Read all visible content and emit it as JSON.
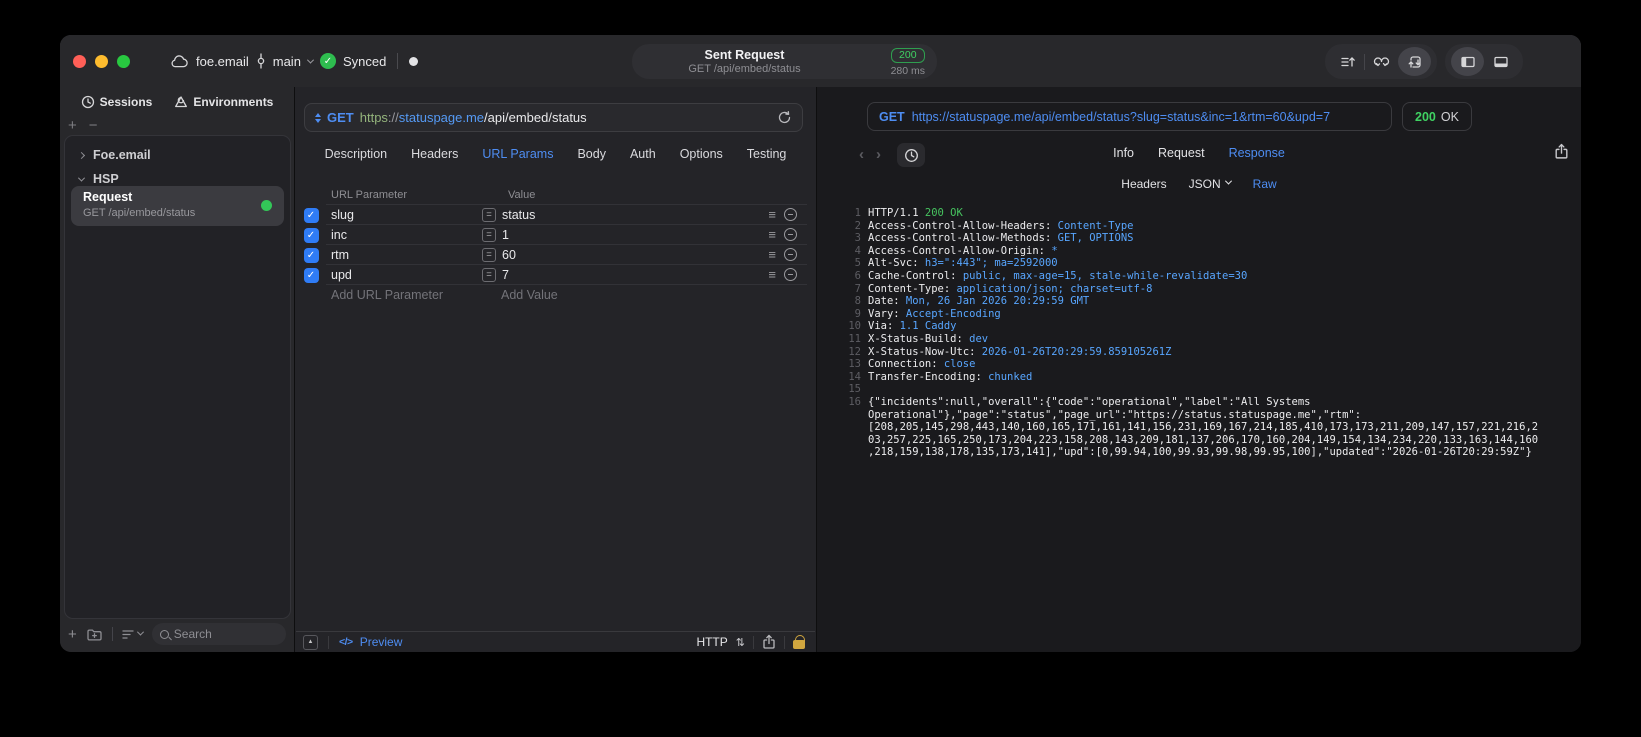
{
  "colors": {
    "accent_blue": "#4e8df2",
    "status_green": "#3fd162",
    "checkbox_blue": "#2f7cf6",
    "lock_gold": "#d0a63f",
    "value_blue": "#58a6ff"
  },
  "icons": {
    "check": "✓",
    "equals": "=",
    "hamburger": "≡",
    "sort": "⇅",
    "code": "</>",
    "back": "‹",
    "forward": "›",
    "plus": "+",
    "minus": "−",
    "up_triangle": "▲"
  },
  "titlebar": {
    "project": "foe.email",
    "branch": "main",
    "sync_status": "Synced",
    "request_title": "Sent Request",
    "request_subtitle": "GET /api/embed/status",
    "status_code": "200",
    "duration": "280 ms"
  },
  "sidebar": {
    "tabs": [
      "Sessions",
      "Environments"
    ],
    "tree": [
      {
        "label": "Foe.email"
      },
      {
        "label": "HSP"
      }
    ],
    "selected_request": {
      "title": "Request",
      "subtitle": "GET /api/embed/status"
    },
    "search_placeholder": "Search"
  },
  "request_editor": {
    "method": "GET",
    "url": {
      "scheme": "https",
      "sep": "://",
      "host": "statuspage.me",
      "path": "/api/embed/status"
    },
    "tabs": [
      "Description",
      "Headers",
      "URL Params",
      "Body",
      "Auth",
      "Options",
      "Testing"
    ],
    "active_tab": "URL Params",
    "params": {
      "columns": [
        "URL Parameter",
        "Value"
      ],
      "rows": [
        {
          "checked": true,
          "name": "slug",
          "value": "status"
        },
        {
          "checked": true,
          "name": "inc",
          "value": "1"
        },
        {
          "checked": true,
          "name": "rtm",
          "value": "60"
        },
        {
          "checked": true,
          "name": "upd",
          "value": "7"
        }
      ],
      "add_name_placeholder": "Add URL Parameter",
      "add_value_placeholder": "Add Value"
    },
    "footer": {
      "preview_label": "Preview",
      "protocol": "HTTP"
    }
  },
  "response_viewer": {
    "method": "GET",
    "url": "https://statuspage.me/api/embed/status?slug=status&inc=1&rtm=60&upd=7",
    "status": {
      "code": "200",
      "text": "OK"
    },
    "tabs": [
      "Info",
      "Request",
      "Response"
    ],
    "active_tab": "Response",
    "subtabs": [
      "Headers",
      "JSON",
      "Raw"
    ],
    "active_subtab": "Raw",
    "status_line": {
      "num": "1",
      "protocol": "HTTP/1.1",
      "status": "200 OK"
    },
    "headers": [
      {
        "num": "2",
        "name": "Access-Control-Allow-Headers:",
        "value": "Content-Type"
      },
      {
        "num": "3",
        "name": "Access-Control-Allow-Methods:",
        "value": "GET, OPTIONS"
      },
      {
        "num": "4",
        "name": "Access-Control-Allow-Origin:",
        "value": "*"
      },
      {
        "num": "5",
        "name": "Alt-Svc:",
        "value": "h3=\":443\"; ma=2592000"
      },
      {
        "num": "6",
        "name": "Cache-Control:",
        "value": "public, max-age=15, stale-while-revalidate=30"
      },
      {
        "num": "7",
        "name": "Content-Type:",
        "value": "application/json; charset=utf-8"
      },
      {
        "num": "8",
        "name": "Date:",
        "value": "Mon, 26 Jan 2026 20:29:59 GMT"
      },
      {
        "num": "9",
        "name": "Vary:",
        "value": "Accept-Encoding"
      },
      {
        "num": "10",
        "name": "Via:",
        "value": "1.1 Caddy"
      },
      {
        "num": "11",
        "name": "X-Status-Build:",
        "value": "dev"
      },
      {
        "num": "12",
        "name": "X-Status-Now-Utc:",
        "value": "2026-01-26T20:29:59.859105261Z"
      },
      {
        "num": "13",
        "name": "Connection:",
        "value": "close"
      },
      {
        "num": "14",
        "name": "Transfer-Encoding:",
        "value": "chunked"
      }
    ],
    "blank_line": {
      "num": "15"
    },
    "body_line": {
      "num": "16",
      "text": "{\"incidents\":null,\"overall\":{\"code\":\"operational\",\"label\":\"All Systems Operational\"},\"page\":\"status\",\"page_url\":\"https://status.statuspage.me\",\"rtm\":[208,205,145,298,443,140,160,165,171,161,141,156,231,169,167,214,185,410,173,173,211,209,147,157,221,216,203,257,225,165,250,173,204,223,158,208,143,209,181,137,206,170,160,204,149,154,134,234,220,133,163,144,160,218,159,138,178,135,173,141],\"upd\":[0,99.94,100,99.93,99.98,99.95,100],\"updated\":\"2026-01-26T20:29:59Z\"}"
    }
  }
}
